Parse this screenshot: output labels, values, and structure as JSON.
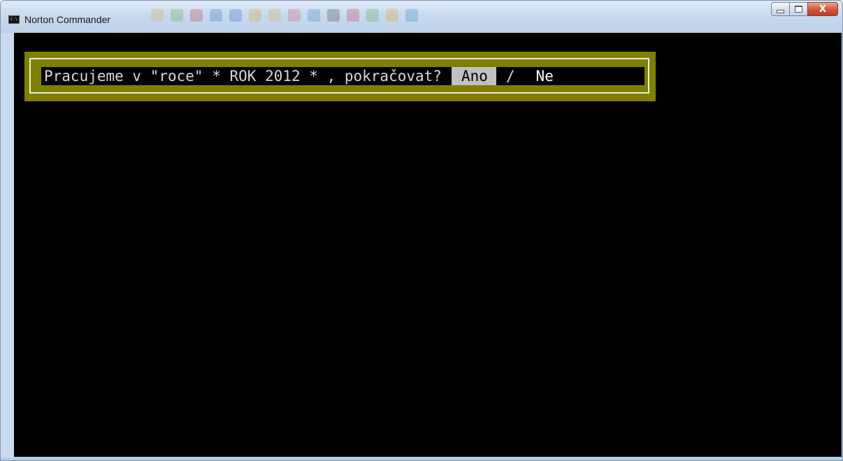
{
  "window": {
    "title": "Norton Commander",
    "icon_text": "C:\\",
    "controls": {
      "minimize_icon": "minimize-icon",
      "maximize_icon": "maximize-icon",
      "close_glyph": "X"
    }
  },
  "dialog": {
    "prompt": "Pracujeme v \"roce\" * ROK 2012 * , pokračovat?",
    "yes_label": "Ano",
    "separator": "/",
    "no_label": "Ne",
    "selected_option": "Ano"
  },
  "colors": {
    "console_background": "#000000",
    "dialog_background": "#808000",
    "dialog_border": "#e8e8e8",
    "prompt_text": "#d8d8d8",
    "selected_button_background": "#c0c0c0",
    "selected_button_text": "#000000"
  }
}
